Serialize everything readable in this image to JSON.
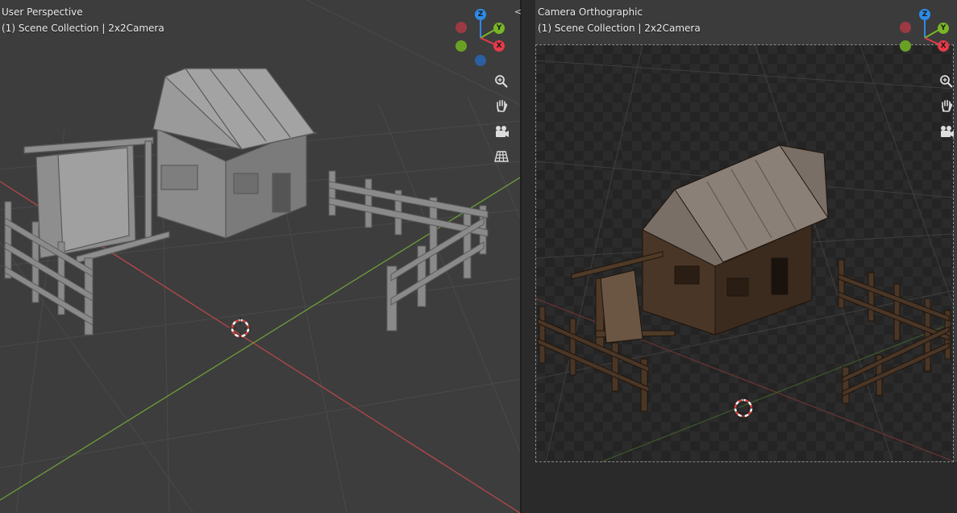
{
  "left_viewport": {
    "title": "User Perspective",
    "collection": "(1) Scene Collection | 2x2Camera",
    "gizmo": {
      "z": "Z",
      "y": "Y",
      "x": "X"
    },
    "tools": [
      "zoom-icon",
      "hand-icon",
      "camera-icon",
      "grid-icon"
    ]
  },
  "right_viewport": {
    "title": "Camera Orthographic",
    "collection": "(1) Scene Collection | 2x2Camera",
    "gizmo": {
      "z": "Z",
      "y": "Y",
      "x": "X"
    },
    "tools": [
      "zoom-icon",
      "hand-icon",
      "camera-icon"
    ]
  },
  "split_handle": "<>",
  "colors": {
    "axis_x": "#c8484a",
    "axis_y": "#6fa33a",
    "axis_z": "#2f7fd4",
    "gizmo_x": "#e63a4a",
    "gizmo_y": "#7ab526",
    "gizmo_z": "#2e8ae6"
  }
}
